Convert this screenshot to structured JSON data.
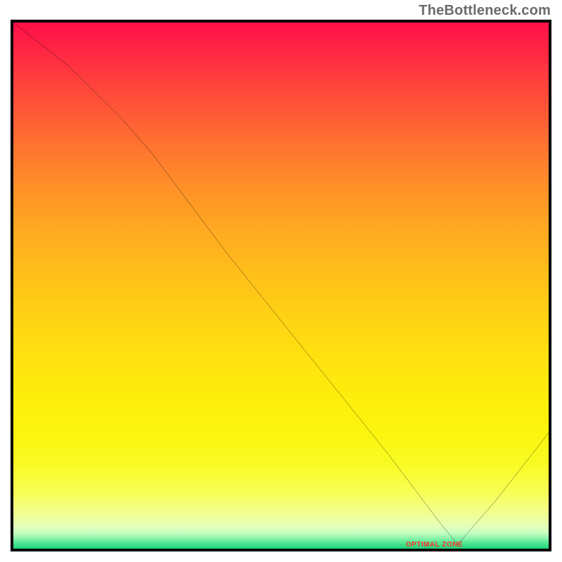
{
  "watermark": "TheBottleneck.com",
  "band_label": "OPTIMAL ZONE",
  "colors": {
    "line": "#000000",
    "label": "#ff2a2a"
  },
  "chart_data": {
    "type": "line",
    "title": "",
    "xlabel": "",
    "ylabel": "",
    "xlim": [
      0,
      100
    ],
    "ylim": [
      0,
      100
    ],
    "grid": false,
    "legend": false,
    "notes": "Square plot with vertical color gradient (red at top → orange → yellow → pale yellow → thin green band at bottom). A single black curve descends from upper-left to a minimum near x≈83 in the green band, then rises toward the right edge. A small red label marks the optimal (minimum) zone.",
    "series": [
      {
        "name": "curve",
        "x": [
          0,
          10,
          20,
          26,
          40,
          55,
          70,
          80,
          83,
          90,
          100
        ],
        "y": [
          100,
          92,
          82,
          75,
          56,
          37,
          18,
          4.5,
          0.8,
          9,
          22
        ]
      }
    ],
    "annotations": [
      {
        "text": "OPTIMAL ZONE",
        "x": 78,
        "y": 1.2
      }
    ],
    "gradient_stops": [
      {
        "pos": 0.0,
        "color": "#ff0f48"
      },
      {
        "pos": 0.23,
        "color": "#ff7130"
      },
      {
        "pos": 0.47,
        "color": "#ffbd1a"
      },
      {
        "pos": 0.71,
        "color": "#feed0c"
      },
      {
        "pos": 0.89,
        "color": "#f8ff52"
      },
      {
        "pos": 0.97,
        "color": "#c8ffc3"
      },
      {
        "pos": 1.0,
        "color": "#1ed47a"
      }
    ]
  }
}
